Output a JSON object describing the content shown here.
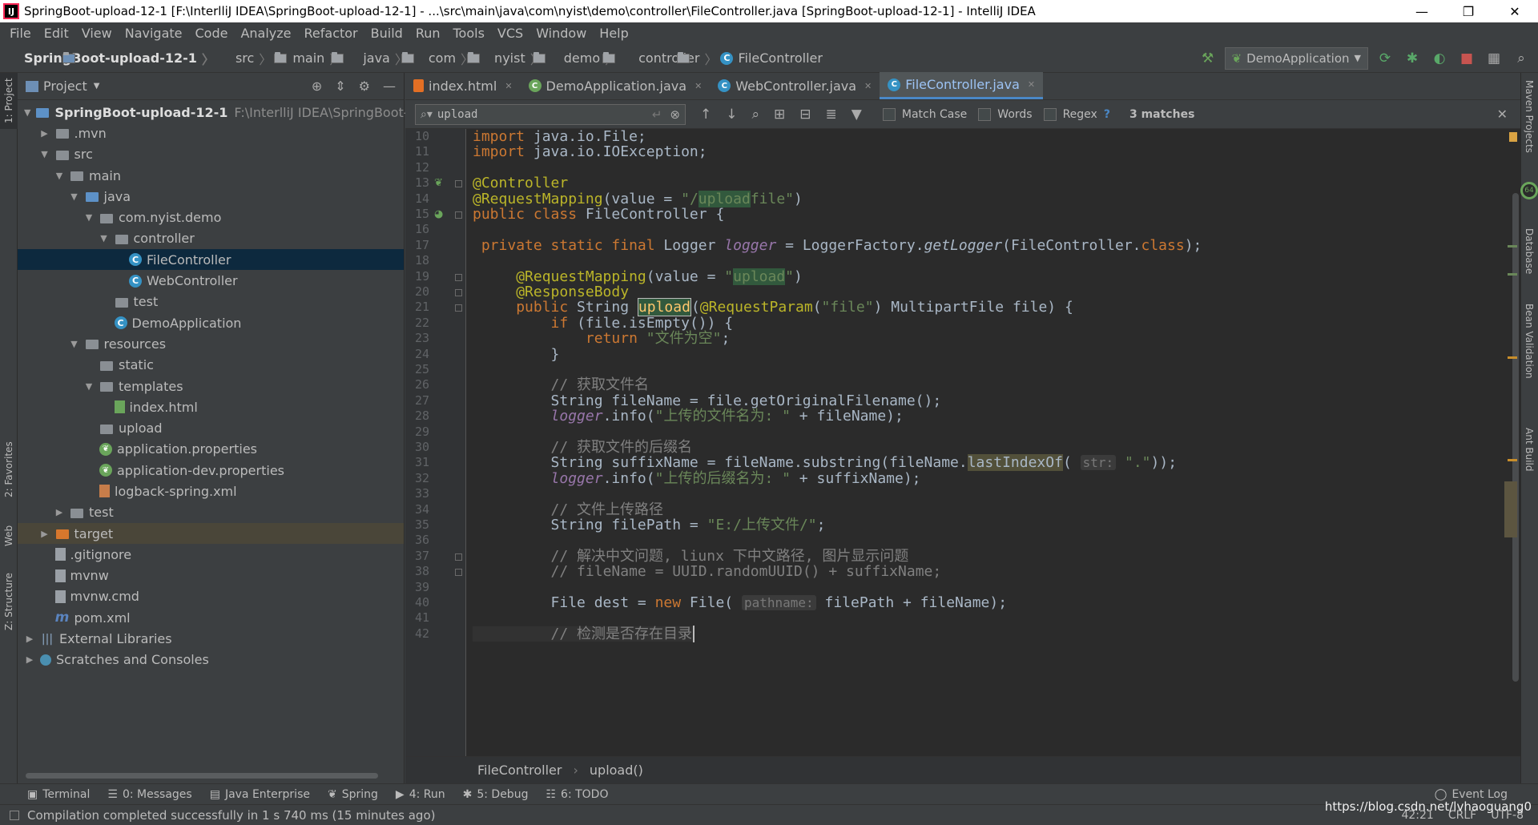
{
  "window": {
    "title": "SpringBoot-upload-12-1 [F:\\InterlliJ IDEA\\SpringBoot-upload-12-1] - ...\\src\\main\\java\\com\\nyist\\demo\\controller\\FileController.java [SpringBoot-upload-12-1] - IntelliJ IDEA",
    "minimize": "—",
    "restore": "❐",
    "close": "✕"
  },
  "menu": [
    "File",
    "Edit",
    "View",
    "Navigate",
    "Code",
    "Analyze",
    "Refactor",
    "Build",
    "Run",
    "Tools",
    "VCS",
    "Window",
    "Help"
  ],
  "nav": {
    "project": "SpringBoot-upload-12-1",
    "crumbs": [
      "src",
      "main",
      "java",
      "com",
      "nyist",
      "demo",
      "controller",
      "FileController"
    ],
    "run_config": "DemoApplication"
  },
  "project_panel": {
    "title": "Project",
    "tree": [
      {
        "depth": 0,
        "arrow": "down",
        "icon": "module",
        "label": "SpringBoot-upload-12-1",
        "path": "F:\\InterlliJ IDEA\\SpringBoot-uplo",
        "bold": true
      },
      {
        "depth": 1,
        "arrow": "right",
        "icon": "folder",
        "label": ".mvn"
      },
      {
        "depth": 1,
        "arrow": "down",
        "icon": "folder",
        "label": "src"
      },
      {
        "depth": 2,
        "arrow": "down",
        "icon": "folder",
        "label": "main"
      },
      {
        "depth": 3,
        "arrow": "down",
        "icon": "folder-src",
        "label": "java"
      },
      {
        "depth": 4,
        "arrow": "down",
        "icon": "folder",
        "label": "com.nyist.demo"
      },
      {
        "depth": 5,
        "arrow": "down",
        "icon": "folder",
        "label": "controller"
      },
      {
        "depth": 6,
        "arrow": "",
        "icon": "class",
        "label": "FileController",
        "selected": true
      },
      {
        "depth": 6,
        "arrow": "",
        "icon": "class",
        "label": "WebController"
      },
      {
        "depth": 5,
        "arrow": "",
        "icon": "folder",
        "label": "test"
      },
      {
        "depth": 5,
        "arrow": "",
        "icon": "spring-class",
        "label": "DemoApplication"
      },
      {
        "depth": 3,
        "arrow": "down",
        "icon": "folder-res",
        "label": "resources"
      },
      {
        "depth": 4,
        "arrow": "",
        "icon": "folder",
        "label": "static"
      },
      {
        "depth": 4,
        "arrow": "down",
        "icon": "folder",
        "label": "templates"
      },
      {
        "depth": 5,
        "arrow": "",
        "icon": "html",
        "label": "index.html"
      },
      {
        "depth": 4,
        "arrow": "",
        "icon": "folder",
        "label": "upload"
      },
      {
        "depth": 4,
        "arrow": "",
        "icon": "spring",
        "label": "application.properties"
      },
      {
        "depth": 4,
        "arrow": "",
        "icon": "spring",
        "label": "application-dev.properties"
      },
      {
        "depth": 4,
        "arrow": "",
        "icon": "xml",
        "label": "logback-spring.xml"
      },
      {
        "depth": 2,
        "arrow": "right",
        "icon": "folder",
        "label": "test"
      },
      {
        "depth": 1,
        "arrow": "right",
        "icon": "folder-orange",
        "label": "target",
        "highlight": true
      },
      {
        "depth": 1,
        "arrow": "",
        "icon": "file",
        "label": ".gitignore"
      },
      {
        "depth": 1,
        "arrow": "",
        "icon": "file",
        "label": "mvnw"
      },
      {
        "depth": 1,
        "arrow": "",
        "icon": "file",
        "label": "mvnw.cmd"
      },
      {
        "depth": 1,
        "arrow": "",
        "icon": "maven",
        "label": "pom.xml"
      },
      {
        "depth": 0,
        "arrow": "right",
        "icon": "library",
        "label": "External Libraries"
      },
      {
        "depth": 0,
        "arrow": "right",
        "icon": "scratch",
        "label": "Scratches and Consoles"
      }
    ]
  },
  "tabs": [
    {
      "label": "index.html",
      "icon": "html"
    },
    {
      "label": "DemoApplication.java",
      "icon": "spring-class"
    },
    {
      "label": "WebController.java",
      "icon": "class"
    },
    {
      "label": "FileController.java",
      "icon": "class",
      "active": true
    }
  ],
  "find": {
    "query": "upload",
    "match_case": "Match Case",
    "words": "Words",
    "regex": "Regex",
    "help": "?",
    "matches": "3 matches"
  },
  "code_lines": [
    {
      "n": "10",
      "html": "<span class='kw'>import</span> java.io.File;"
    },
    {
      "n": "11",
      "html": "<span class='kw'>import</span> java.io.IOException;"
    },
    {
      "n": "12",
      "html": ""
    },
    {
      "n": "13",
      "html": "<span class='an'>@Controller</span>"
    },
    {
      "n": "14",
      "html": "<span class='an'>@RequestMapping</span>(value = <span class='st'>\"/<span class='mark'>upload</span>file\"</span>)"
    },
    {
      "n": "15",
      "html": "<span class='kw'>public class</span> FileController {"
    },
    {
      "n": "16",
      "html": ""
    },
    {
      "n": "17",
      "html": " <span class='kw'>private static final</span> Logger <span class='it'>logger</span> = LoggerFactory.<span class='fn'>getLogger</span>(FileController.<span class='kw'>class</span>);"
    },
    {
      "n": "18",
      "html": ""
    },
    {
      "n": "19",
      "html": "     <span class='an'>@RequestMapping</span>(value = <span class='st'>\"<span class='mark'>upload</span>\"</span>)"
    },
    {
      "n": "20",
      "html": "     <span class='an'>@ResponseBody</span>"
    },
    {
      "n": "21",
      "html": "     <span class='kw'>public</span> String <span class='mark2 mt'>upload</span>(<span class='an'>@RequestParam</span>(<span class='st'>\"file\"</span>) MultipartFile file) {"
    },
    {
      "n": "22",
      "html": "         <span class='kw'>if</span> (file.isEmpty()) {"
    },
    {
      "n": "23",
      "html": "             <span class='kw'>return</span> <span class='st'>\"文件为空\"</span>;"
    },
    {
      "n": "24",
      "html": "         }"
    },
    {
      "n": "25",
      "html": ""
    },
    {
      "n": "26",
      "html": "         <span class='cm'>// 获取文件名</span>"
    },
    {
      "n": "27",
      "html": "         String fileName = file.getOriginalFilename();"
    },
    {
      "n": "28",
      "html": "         <span class='it'>logger</span>.info(<span class='st'>\"上传的文件名为: \"</span> + fileName);"
    },
    {
      "n": "29",
      "html": ""
    },
    {
      "n": "30",
      "html": "         <span class='cm'>// 获取文件的后缀名</span>"
    },
    {
      "n": "31",
      "html": "         String suffixName = fileName.substring(fileName.<span style='background:#52503a'>lastIndexOf</span>( <span class='hint'>str:</span> <span class='st'>\".\"</span>));"
    },
    {
      "n": "32",
      "html": "         <span class='it'>logger</span>.info(<span class='st'>\"上传的后缀名为: \"</span> + suffixName);"
    },
    {
      "n": "33",
      "html": ""
    },
    {
      "n": "34",
      "html": "         <span class='cm'>// 文件上传路径</span>"
    },
    {
      "n": "35",
      "html": "         String filePath = <span class='st'>\"E:/上传文件/\"</span>;"
    },
    {
      "n": "36",
      "html": ""
    },
    {
      "n": "37",
      "html": "         <span class='cm'>// 解决中文问题, liunx 下中文路径, 图片显示问题</span>"
    },
    {
      "n": "38",
      "html": "         <span class='cm'>// fileName = UUID.randomUUID() + suffixName;</span>"
    },
    {
      "n": "39",
      "html": ""
    },
    {
      "n": "40",
      "html": "         File dest = <span class='kw'>new</span> File( <span class='hint'>pathname:</span> filePath + fileName);"
    },
    {
      "n": "41",
      "html": ""
    },
    {
      "n": "42",
      "html": "         <span class='cm'>// 检测是否存在目录</span>"
    }
  ],
  "editor_breadcrumbs": [
    "FileController",
    "upload()"
  ],
  "tool_windows": [
    {
      "label": "Terminal",
      "icon": "▣"
    },
    {
      "label": "0: Messages",
      "icon": "☰"
    },
    {
      "label": "Java Enterprise",
      "icon": "▤"
    },
    {
      "label": "Spring",
      "icon": "❦"
    },
    {
      "label": "4: Run",
      "icon": "▶"
    },
    {
      "label": "5: Debug",
      "icon": "✱"
    },
    {
      "label": "6: TODO",
      "icon": "☷"
    }
  ],
  "event_log": "Event Log",
  "status": {
    "message": "Compilation completed successfully in 1 s 740 ms (15 minutes ago)",
    "position": "42:21",
    "line_sep": "CRLF",
    "encoding": "UTF-8",
    "watermark": "https://blog.csdn.net/lvhaoguang0"
  },
  "side_tabs": {
    "left": [
      "1: Project",
      "2: Favorites",
      "Web",
      "Z: Structure"
    ],
    "right": [
      "Maven Projects",
      "Database",
      "Bean Validation",
      "Ant Build"
    ]
  }
}
